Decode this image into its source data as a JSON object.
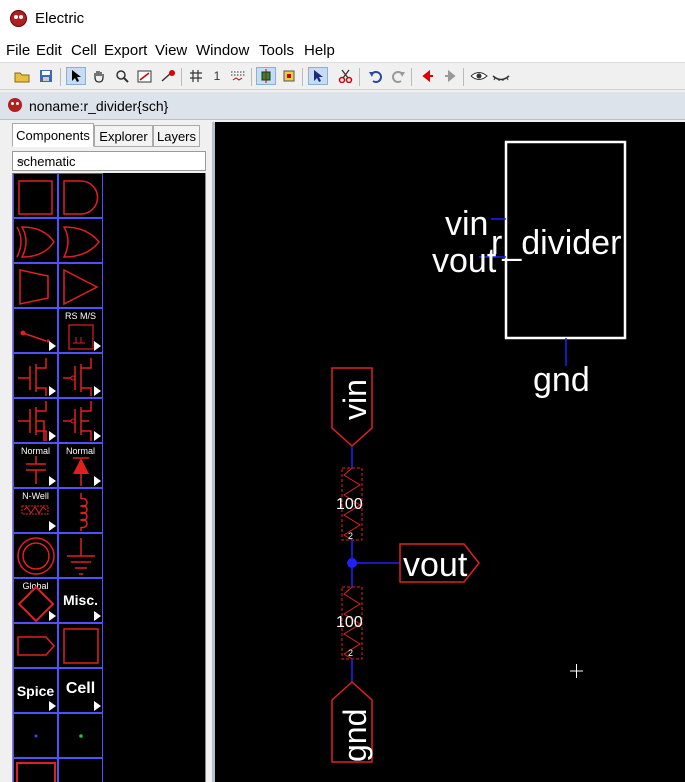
{
  "window": {
    "title": "Electric"
  },
  "menu": [
    "File",
    "Edit",
    "Cell",
    "Export",
    "View",
    "Window",
    "Tools",
    "Help"
  ],
  "toolbar": {
    "units": "1"
  },
  "document": {
    "title": "noname:r_divider{sch}"
  },
  "tabs": [
    "Components",
    "Explorer",
    "Layers"
  ],
  "technology": {
    "selected": "schematic"
  },
  "palette": {
    "latch_label": "RS M/S",
    "cap_label": "Normal",
    "diode_label": "Normal",
    "well_label": "N-Well",
    "global_label": "Global",
    "misc_label": "Misc.",
    "spice_label": "Spice",
    "cell_label": "Cell"
  },
  "schematic": {
    "icon": {
      "name": "r_divider",
      "ports": [
        "vin",
        "vout"
      ],
      "bottom_port": "gnd"
    },
    "pins": {
      "vin": "vin",
      "vout": "vout",
      "gnd": "gnd"
    },
    "resistors": [
      {
        "value": "100",
        "size": "2"
      },
      {
        "value": "100",
        "size": "2"
      }
    ]
  },
  "colors": {
    "canvas": "#000000",
    "component": "#e02020",
    "wire": "#2020ff",
    "text": "#ffffff",
    "palette_grid": "#5050ff"
  }
}
